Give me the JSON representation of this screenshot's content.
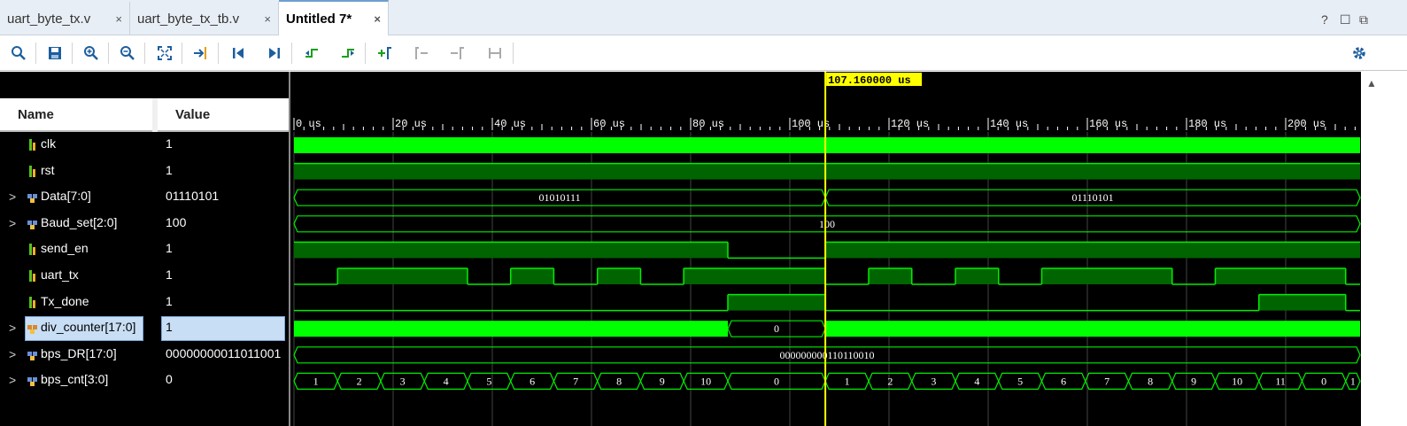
{
  "tabs": [
    {
      "label": "uart_byte_tx.v",
      "close": "×"
    },
    {
      "label": "uart_byte_tx_tb.v",
      "close": "×"
    },
    {
      "label": "Untitled 7*",
      "close": "×"
    }
  ],
  "window_controls": {
    "help": "?",
    "restore": "☐",
    "maximize": "⧉"
  },
  "toolbar_icons": [
    "search-icon",
    "save-icon",
    "zoom-in-icon",
    "zoom-out-icon",
    "zoom-fit-icon",
    "goto-cursor-icon",
    "goto-start-icon",
    "goto-end-icon",
    "prev-transition-icon",
    "next-transition-icon",
    "add-marker-icon",
    "prev-marker-icon",
    "next-marker-icon",
    "swap-cursors-icon",
    "settings-gear-icon"
  ],
  "columns": {
    "name": "Name",
    "value": "Value"
  },
  "cursor": {
    "label": "107.160000  us",
    "time_us": 107.16
  },
  "time_axis": {
    "unit": "us",
    "ticks": [
      "0 us",
      "20 us",
      "40 us",
      "60 us",
      "80 us",
      "100 us",
      "120 us",
      "140 us",
      "160 us",
      "180 us",
      "200 us"
    ],
    "range_us": [
      0,
      215
    ]
  },
  "signals": [
    {
      "name": "clk",
      "value": "1",
      "type": "bit",
      "expandable": false
    },
    {
      "name": "rst",
      "value": "1",
      "type": "bit",
      "expandable": false
    },
    {
      "name": "Data[7:0]",
      "value": "01110101",
      "type": "bus",
      "expandable": true
    },
    {
      "name": "Baud_set[2:0]",
      "value": "100",
      "type": "bus",
      "expandable": true
    },
    {
      "name": "send_en",
      "value": "1",
      "type": "bit",
      "expandable": false
    },
    {
      "name": "uart_tx",
      "value": "1",
      "type": "bit",
      "expandable": false
    },
    {
      "name": "Tx_done",
      "value": "1",
      "type": "bit",
      "expandable": false
    },
    {
      "name": "div_counter[17:0]",
      "value": "1",
      "type": "bus",
      "expandable": true,
      "selected": true
    },
    {
      "name": "bps_DR[17:0]",
      "value": "00000000011011001",
      "type": "bus",
      "expandable": true
    },
    {
      "name": "bps_cnt[3:0]",
      "value": "0",
      "type": "bus",
      "expandable": true
    }
  ],
  "waves": {
    "Data": [
      {
        "from": 0,
        "to": 107.16,
        "label": "01010111"
      },
      {
        "from": 107.16,
        "to": 215,
        "label": "01110101"
      }
    ],
    "Baud_set": [
      {
        "from": 0,
        "to": 215,
        "label": "100"
      }
    ],
    "send_en": [
      [
        0,
        1
      ],
      [
        87.5,
        0
      ],
      [
        107.16,
        1
      ]
    ],
    "uart_tx": [
      [
        0,
        0
      ],
      [
        8.8,
        1
      ],
      [
        35,
        0
      ],
      [
        43.7,
        1
      ],
      [
        52.4,
        0
      ],
      [
        61.2,
        1
      ],
      [
        69.9,
        0
      ],
      [
        78.6,
        1
      ],
      [
        107.16,
        0
      ],
      [
        115.9,
        1
      ],
      [
        124.6,
        0
      ],
      [
        133.4,
        1
      ],
      [
        142.1,
        0
      ],
      [
        150.8,
        1
      ],
      [
        177.1,
        0
      ],
      [
        185.8,
        1
      ],
      [
        212.1,
        0
      ]
    ],
    "Tx_done": [
      [
        0,
        0
      ],
      [
        87.5,
        1
      ],
      [
        107.16,
        0
      ],
      [
        194.6,
        1
      ],
      [
        212.1,
        0
      ]
    ],
    "div_counter": [
      {
        "from": 0,
        "to": 87.5,
        "label": "",
        "dense": true
      },
      {
        "from": 87.5,
        "to": 107.16,
        "label": "0"
      },
      {
        "from": 107.16,
        "to": 215,
        "label": "",
        "dense": true
      }
    ],
    "bps_DR": [
      {
        "from": 0,
        "to": 215,
        "label": "000000000110110010"
      }
    ],
    "bps_cnt": [
      {
        "from": 0,
        "to": 8.8,
        "label": "1"
      },
      {
        "from": 8.8,
        "to": 17.5,
        "label": "2"
      },
      {
        "from": 17.5,
        "to": 26.3,
        "label": "3"
      },
      {
        "from": 26.3,
        "to": 35,
        "label": "4"
      },
      {
        "from": 35,
        "to": 43.7,
        "label": "5"
      },
      {
        "from": 43.7,
        "to": 52.4,
        "label": "6"
      },
      {
        "from": 52.4,
        "to": 61.2,
        "label": "7"
      },
      {
        "from": 61.2,
        "to": 69.9,
        "label": "8"
      },
      {
        "from": 69.9,
        "to": 78.6,
        "label": "9"
      },
      {
        "from": 78.6,
        "to": 87.5,
        "label": "10"
      },
      {
        "from": 87.5,
        "to": 107.16,
        "label": "0"
      },
      {
        "from": 107.16,
        "to": 115.9,
        "label": "1"
      },
      {
        "from": 115.9,
        "to": 124.6,
        "label": "2"
      },
      {
        "from": 124.6,
        "to": 133.4,
        "label": "3"
      },
      {
        "from": 133.4,
        "to": 142.1,
        "label": "4"
      },
      {
        "from": 142.1,
        "to": 150.8,
        "label": "5"
      },
      {
        "from": 150.8,
        "to": 159.6,
        "label": "6"
      },
      {
        "from": 159.6,
        "to": 168.3,
        "label": "7"
      },
      {
        "from": 168.3,
        "to": 177.1,
        "label": "8"
      },
      {
        "from": 177.1,
        "to": 185.8,
        "label": "9"
      },
      {
        "from": 185.8,
        "to": 194.6,
        "label": "10"
      },
      {
        "from": 194.6,
        "to": 203.3,
        "label": "11"
      },
      {
        "from": 203.3,
        "to": 212.1,
        "label": "0"
      },
      {
        "from": 212.1,
        "to": 215,
        "label": "1"
      }
    ]
  },
  "colors": {
    "wave_bright": "#00ff00",
    "wave_dark": "#006400",
    "wave_line": "#00ee00",
    "cursor": "#ffff00",
    "grid": "#444444",
    "background": "#000000",
    "bus_text": "#ffffff"
  }
}
